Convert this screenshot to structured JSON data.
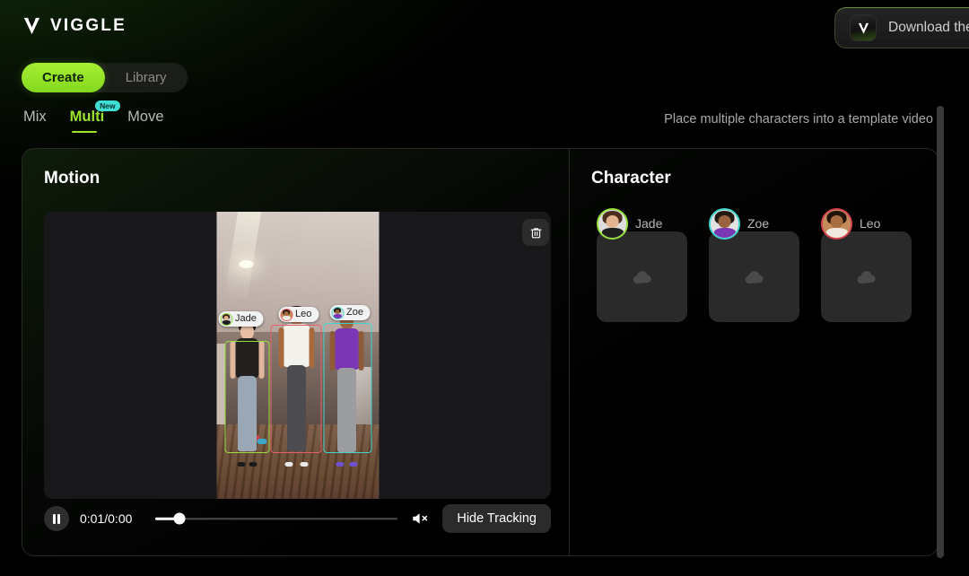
{
  "brand": {
    "name": "VIGGLE",
    "logo_icon": "viggle-v-logo"
  },
  "header": {
    "download_button": {
      "label": "Download the",
      "app_icon": "viggle-app-icon"
    }
  },
  "mode_toggle": {
    "options": [
      {
        "label": "Create",
        "active": true
      },
      {
        "label": "Library",
        "active": false
      }
    ]
  },
  "subtabs": {
    "items": [
      {
        "label": "Mix",
        "active": false,
        "badge": ""
      },
      {
        "label": "Multi",
        "active": true,
        "badge": "New"
      },
      {
        "label": "Move",
        "active": false,
        "badge": ""
      }
    ],
    "description": "Place multiple characters into a template video"
  },
  "motion_panel": {
    "title": "Motion",
    "delete_icon": "trash-icon",
    "tracking_tags": [
      {
        "name": "Jade",
        "color": "#95e03c"
      },
      {
        "name": "Leo",
        "color": "#e8616a"
      },
      {
        "name": "Zoe",
        "color": "#3fd6cf"
      }
    ],
    "player": {
      "state_icon": "pause-icon",
      "time": "0:01/0:00",
      "progress_percent": 10,
      "volume_icon": "speaker-muted-icon",
      "hide_tracking_label": "Hide Tracking"
    }
  },
  "character_panel": {
    "title": "Character",
    "slots": [
      {
        "name": "Jade",
        "ring_color": "#95e03c",
        "upload_icon": "cloud-upload-icon"
      },
      {
        "name": "Zoe",
        "ring_color": "#3fd6cf",
        "upload_icon": "cloud-upload-icon"
      },
      {
        "name": "Leo",
        "ring_color": "#d6434f",
        "upload_icon": "cloud-upload-icon"
      }
    ]
  },
  "theme": {
    "accent_green": "#9be42c",
    "accent_cyan": "#3fdfd6",
    "background": "#000000"
  }
}
